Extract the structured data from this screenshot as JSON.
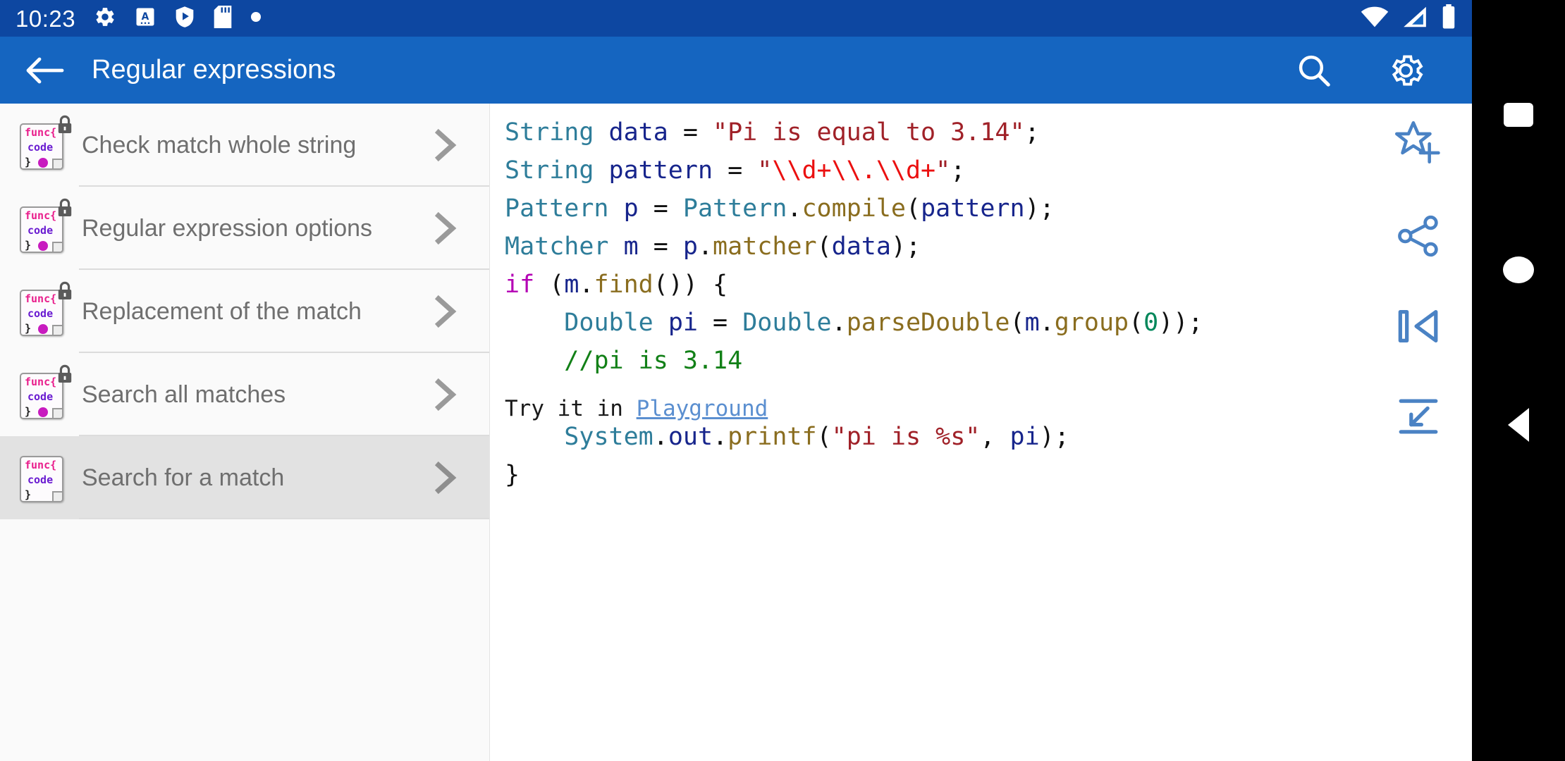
{
  "status_bar": {
    "time": "10:23",
    "left_icons": [
      "gear-icon",
      "a-text-box-icon",
      "shield-play-icon",
      "sd-card-icon",
      "dot-icon"
    ],
    "right_icons": [
      "wifi-icon",
      "signal-icon",
      "battery-icon"
    ],
    "background_color": "#0D47A1"
  },
  "app_bar": {
    "title": "Regular expressions",
    "back_label": "back-arrow",
    "search_label": "search-icon",
    "settings_label": "gear-icon",
    "background_color": "#1565C0"
  },
  "sidebar": {
    "items": [
      {
        "label": "Check match whole string",
        "locked": true,
        "selected": false
      },
      {
        "label": "Regular expression options",
        "locked": true,
        "selected": false
      },
      {
        "label": "Replacement of the match",
        "locked": true,
        "selected": false
      },
      {
        "label": "Search all matches",
        "locked": true,
        "selected": false
      },
      {
        "label": "Search for a match",
        "locked": false,
        "selected": true
      }
    ],
    "icon_text": {
      "line1": "func{",
      "line2": "code",
      "line3": "}"
    },
    "selected_background": "#E2E2E2"
  },
  "code_pane": {
    "language": "java",
    "lines": [
      [
        {
          "t": "String",
          "c": "t-type"
        },
        {
          "t": " ",
          "c": "t-plain"
        },
        {
          "t": "data",
          "c": "t-var"
        },
        {
          "t": " = ",
          "c": "t-plain"
        },
        {
          "t": "\"Pi is equal to 3.14\"",
          "c": "t-str"
        },
        {
          "t": ";",
          "c": "t-plain"
        }
      ],
      [
        {
          "t": "String",
          "c": "t-type"
        },
        {
          "t": " ",
          "c": "t-plain"
        },
        {
          "t": "pattern",
          "c": "t-var"
        },
        {
          "t": " = ",
          "c": "t-plain"
        },
        {
          "t": "\"",
          "c": "t-str"
        },
        {
          "t": "\\\\d+\\\\.\\\\d+",
          "c": "t-esc"
        },
        {
          "t": "\"",
          "c": "t-str"
        },
        {
          "t": ";",
          "c": "t-plain"
        }
      ],
      [
        {
          "t": "Pattern",
          "c": "t-type"
        },
        {
          "t": " ",
          "c": "t-plain"
        },
        {
          "t": "p",
          "c": "t-var"
        },
        {
          "t": " = ",
          "c": "t-plain"
        },
        {
          "t": "Pattern",
          "c": "t-type"
        },
        {
          "t": ".",
          "c": "t-plain"
        },
        {
          "t": "compile",
          "c": "t-method"
        },
        {
          "t": "(",
          "c": "t-plain"
        },
        {
          "t": "pattern",
          "c": "t-var"
        },
        {
          "t": ");",
          "c": "t-plain"
        }
      ],
      [
        {
          "t": "Matcher",
          "c": "t-type"
        },
        {
          "t": " ",
          "c": "t-plain"
        },
        {
          "t": "m",
          "c": "t-var"
        },
        {
          "t": " = ",
          "c": "t-plain"
        },
        {
          "t": "p",
          "c": "t-var"
        },
        {
          "t": ".",
          "c": "t-plain"
        },
        {
          "t": "matcher",
          "c": "t-method"
        },
        {
          "t": "(",
          "c": "t-plain"
        },
        {
          "t": "data",
          "c": "t-var"
        },
        {
          "t": ");",
          "c": "t-plain"
        }
      ],
      [
        {
          "t": "if",
          "c": "t-kw"
        },
        {
          "t": " (",
          "c": "t-plain"
        },
        {
          "t": "m",
          "c": "t-var"
        },
        {
          "t": ".",
          "c": "t-plain"
        },
        {
          "t": "find",
          "c": "t-method"
        },
        {
          "t": "()) {",
          "c": "t-plain"
        }
      ],
      [
        {
          "t": "    ",
          "c": "t-plain"
        },
        {
          "t": "Double",
          "c": "t-type"
        },
        {
          "t": " ",
          "c": "t-plain"
        },
        {
          "t": "pi",
          "c": "t-var"
        },
        {
          "t": " = ",
          "c": "t-plain"
        },
        {
          "t": "Double",
          "c": "t-type"
        },
        {
          "t": ".",
          "c": "t-plain"
        },
        {
          "t": "parseDouble",
          "c": "t-method"
        },
        {
          "t": "(",
          "c": "t-plain"
        },
        {
          "t": "m",
          "c": "t-var"
        },
        {
          "t": ".",
          "c": "t-plain"
        },
        {
          "t": "group",
          "c": "t-method"
        },
        {
          "t": "(",
          "c": "t-plain"
        },
        {
          "t": "0",
          "c": "t-num"
        },
        {
          "t": "));",
          "c": "t-plain"
        }
      ],
      [
        {
          "t": "    ",
          "c": "t-plain"
        },
        {
          "t": "//pi is 3.14",
          "c": "t-comment"
        }
      ],
      [
        {
          "t": " ",
          "c": "t-plain"
        }
      ],
      [
        {
          "t": "    ",
          "c": "t-plain"
        },
        {
          "t": "System",
          "c": "t-type"
        },
        {
          "t": ".",
          "c": "t-plain"
        },
        {
          "t": "out",
          "c": "t-var"
        },
        {
          "t": ".",
          "c": "t-plain"
        },
        {
          "t": "printf",
          "c": "t-method"
        },
        {
          "t": "(",
          "c": "t-plain"
        },
        {
          "t": "\"pi is %s\"",
          "c": "t-str"
        },
        {
          "t": ", ",
          "c": "t-plain"
        },
        {
          "t": "pi",
          "c": "t-var"
        },
        {
          "t": ");",
          "c": "t-plain"
        }
      ],
      [
        {
          "t": "}",
          "c": "t-plain"
        }
      ]
    ],
    "footer_prefix": "Try it in ",
    "footer_link": "Playground"
  },
  "action_rail": {
    "buttons": [
      {
        "name": "add-to-favorites-icon",
        "label": "Add to favorites"
      },
      {
        "name": "share-icon",
        "label": "Share"
      },
      {
        "name": "skip-to-start-icon",
        "label": "Go to start"
      },
      {
        "name": "wrap-text-icon",
        "label": "Toggle wrap"
      }
    ],
    "color": "#4A82C4"
  },
  "nav_bar": {
    "buttons": [
      "recents-button",
      "home-button",
      "back-button"
    ],
    "background_color": "#000000"
  }
}
